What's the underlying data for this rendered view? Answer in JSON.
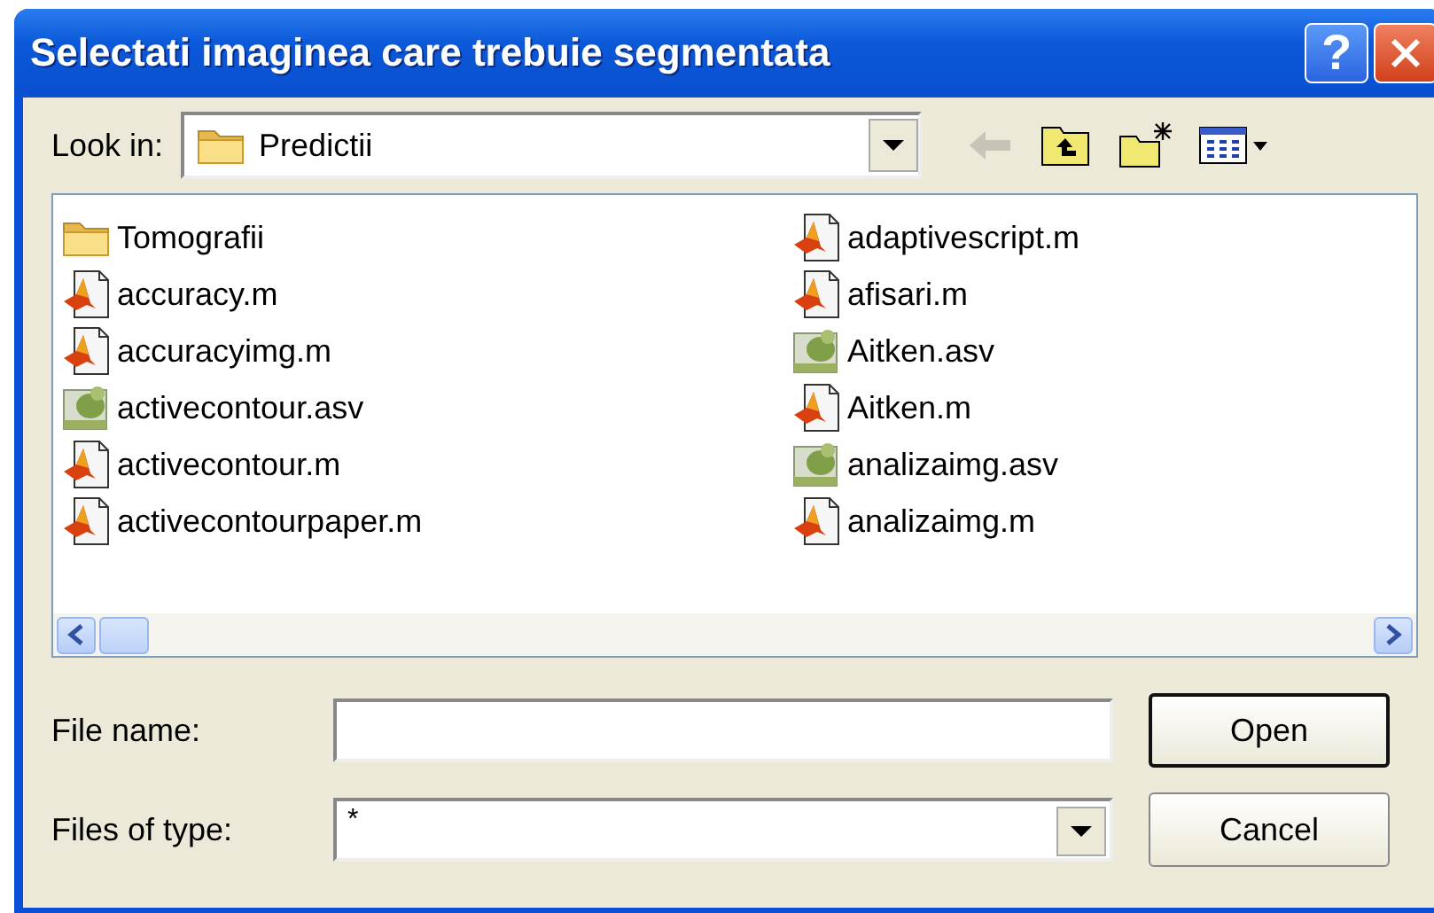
{
  "window": {
    "title": "Selectati imaginea care trebuie segmentata",
    "help_button": "?"
  },
  "look_in": {
    "label": "Look in:",
    "value": "Predictii"
  },
  "files": [
    {
      "name": "Tomografii",
      "kind": "folder"
    },
    {
      "name": "accuracy.m",
      "kind": "m"
    },
    {
      "name": "accuracyimg.m",
      "kind": "m"
    },
    {
      "name": "activecontour.asv",
      "kind": "asv"
    },
    {
      "name": "activecontour.m",
      "kind": "m"
    },
    {
      "name": "activecontourpaper.m",
      "kind": "m"
    },
    {
      "name": "adaptivescript.m",
      "kind": "m"
    },
    {
      "name": "afisari.m",
      "kind": "m"
    },
    {
      "name": "Aitken.asv",
      "kind": "asv"
    },
    {
      "name": "Aitken.m",
      "kind": "m"
    },
    {
      "name": "analizaimg.asv",
      "kind": "asv"
    },
    {
      "name": "analizaimg.m",
      "kind": "m"
    }
  ],
  "file_name": {
    "label": "File name:"
  },
  "files_of_type": {
    "label": "Files of type:",
    "value": "*"
  },
  "buttons": [
    {
      "label": "Open",
      "default": true
    },
    {
      "label": "Cancel",
      "default": false
    }
  ]
}
